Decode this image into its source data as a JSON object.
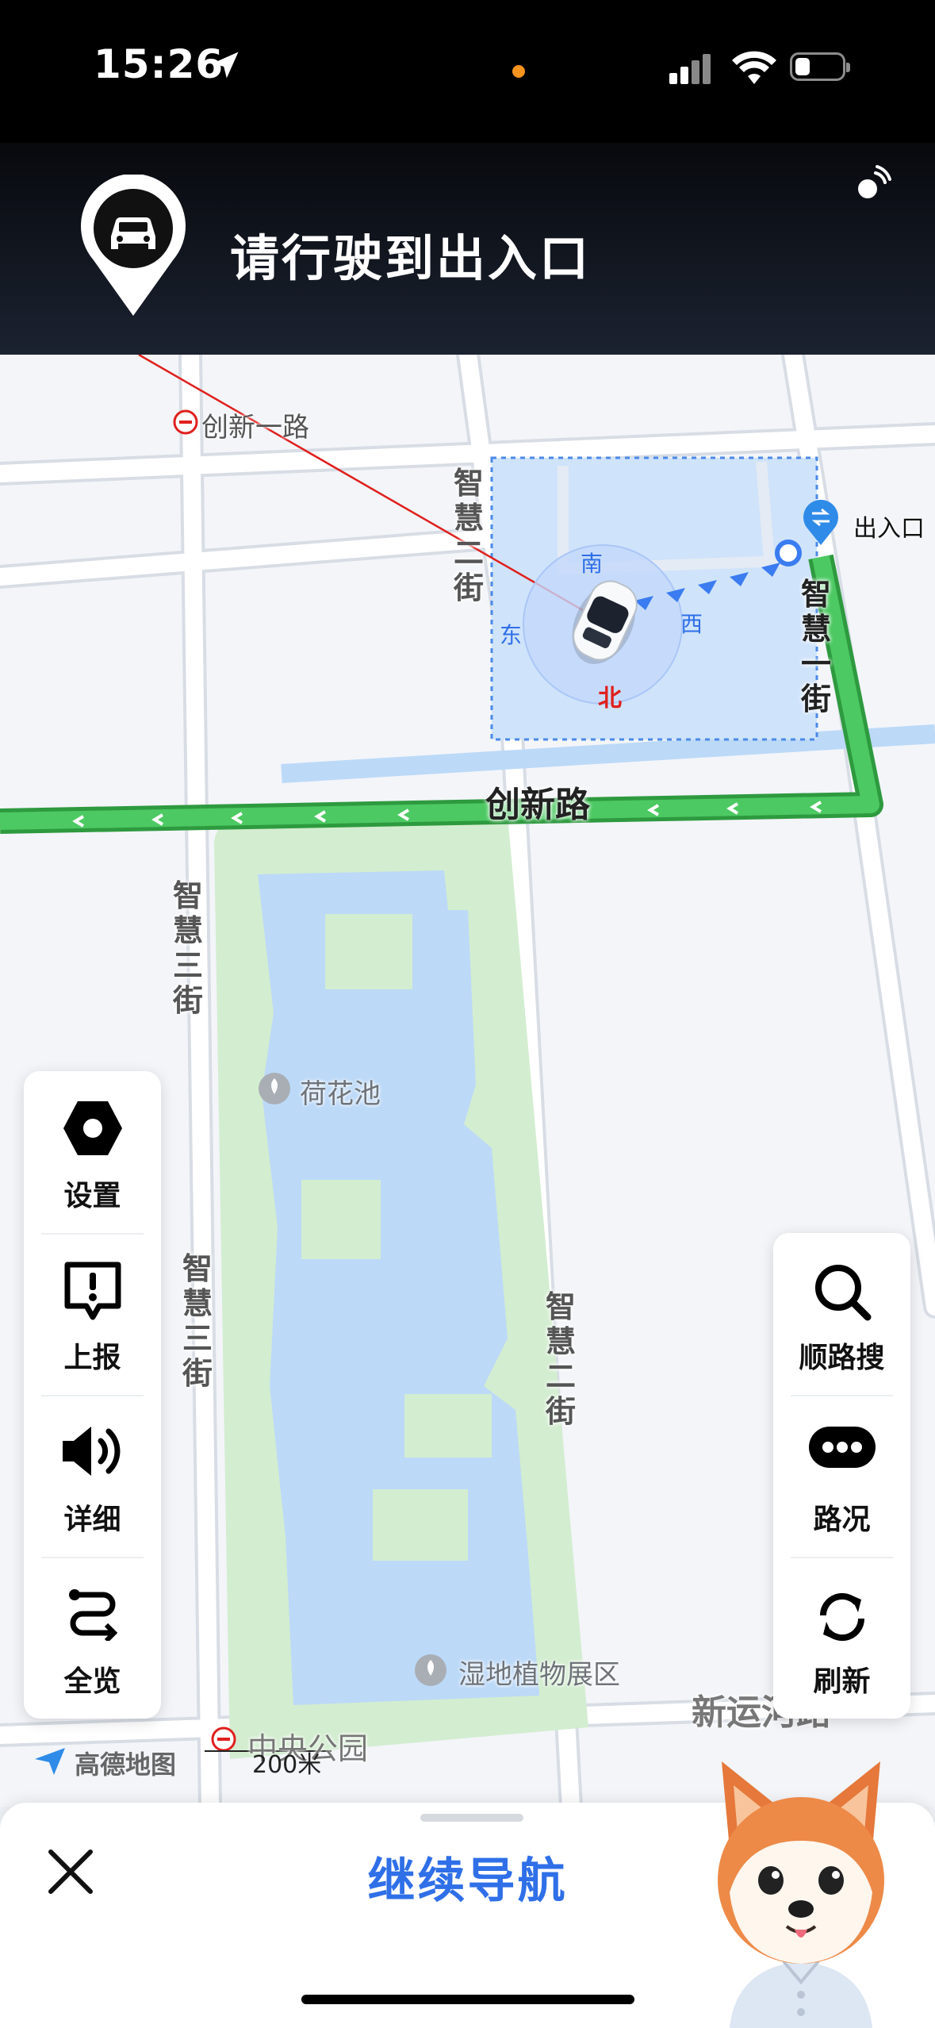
{
  "status_bar": {
    "time": "15:26",
    "colors": {
      "background": "#000000",
      "dot": "#f7931e"
    }
  },
  "header": {
    "title": "请行驶到出入口",
    "icon": "car-location-pin-icon",
    "right_icon": "sound-wave-icon"
  },
  "map": {
    "road_labels": {
      "chuangxin_yilu": "创新一路",
      "chuangxin_lu": "创新路",
      "zhihui_erjie_top": "智慧二街",
      "zhihui_erjie_mid": "智慧二街",
      "zhihui_yijie": "智慧一街",
      "zhihui_sanjie_top": "智慧三街",
      "zhihui_sanjie_bottom": "智慧三街",
      "xinyunhe_lu": "新运河路",
      "zhongyang_gongyuan": "中央公园"
    },
    "pois": {
      "hehuachi": "荷花池",
      "shidi": "湿地植物展区",
      "entrance": "出入口"
    },
    "compass": {
      "north": "北",
      "south": "南",
      "east": "东",
      "west": "西"
    },
    "scale": "200米",
    "brand": "高德地图",
    "colors": {
      "route": "#3fbf5a",
      "water": "#bcd9f8",
      "green": "#d3edd0",
      "area": "#cfe3fb"
    }
  },
  "left_panel": [
    {
      "label": "设置",
      "icon": "hexagon-settings-icon"
    },
    {
      "label": "上报",
      "icon": "report-alert-icon"
    },
    {
      "label": "详细",
      "icon": "speaker-icon"
    },
    {
      "label": "全览",
      "icon": "route-overview-icon"
    }
  ],
  "right_panel": [
    {
      "label": "顺路搜",
      "icon": "search-icon"
    },
    {
      "label": "路况",
      "icon": "traffic-dots-icon"
    },
    {
      "label": "刷新",
      "icon": "refresh-icon"
    }
  ],
  "bottom": {
    "continue_label": "继续导航",
    "close_icon": "close-icon",
    "mascot": "shiba-dog-mascot"
  }
}
